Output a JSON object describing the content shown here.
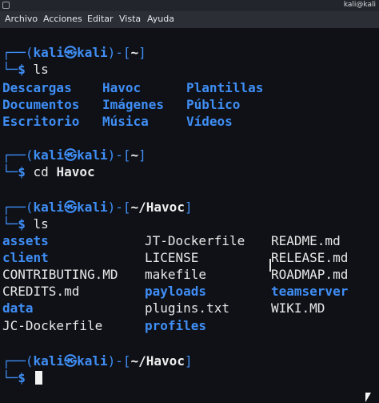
{
  "window": {
    "title": "kali@kali"
  },
  "menu": [
    "Archivo",
    "Acciones",
    "Editar",
    "Vista",
    "Ayuda"
  ],
  "prompt": {
    "user": "kali",
    "at": "㉿",
    "host": "kali",
    "home_dir": "~",
    "havoc_dir": "~/Havoc",
    "symbol": "$"
  },
  "session": [
    {
      "cwd": "~",
      "command": "ls"
    },
    {
      "cwd": "~",
      "command_name": "cd",
      "command_arg": "Havoc"
    },
    {
      "cwd": "~/Havoc",
      "command": "ls"
    },
    {
      "cwd": "~/Havoc",
      "command": ""
    }
  ],
  "home_listing": [
    [
      "Descargas",
      "Havoc",
      "Plantillas"
    ],
    [
      "Documentos",
      "Imágenes",
      "Público"
    ],
    [
      "Escritorio",
      "Música",
      "Vídeos"
    ]
  ],
  "havoc_listing": [
    [
      {
        "n": "assets",
        "t": "dir"
      },
      {
        "n": "JT-Dockerfile",
        "t": "file"
      },
      {
        "n": "README.md",
        "t": "file"
      }
    ],
    [
      {
        "n": "client",
        "t": "dir"
      },
      {
        "n": "LICENSE",
        "t": "file"
      },
      {
        "n": "RELEASE.md",
        "t": "file"
      }
    ],
    [
      {
        "n": "CONTRIBUTING.MD",
        "t": "file"
      },
      {
        "n": "makefile",
        "t": "file"
      },
      {
        "n": "ROADMAP.md",
        "t": "file"
      }
    ],
    [
      {
        "n": "CREDITS.md",
        "t": "file"
      },
      {
        "n": "payloads",
        "t": "dir"
      },
      {
        "n": "teamserver",
        "t": "dir"
      }
    ],
    [
      {
        "n": "data",
        "t": "dir"
      },
      {
        "n": "plugins.txt",
        "t": "file"
      },
      {
        "n": "WIKI.MD",
        "t": "file"
      }
    ],
    [
      {
        "n": "JC-Dockerfile",
        "t": "file"
      },
      {
        "n": "profiles",
        "t": "dir"
      },
      {
        "n": "",
        "t": "file"
      }
    ]
  ],
  "colors": {
    "background": "#0f1117",
    "prompt": "#3f8ef5",
    "directory": "#3f8ef5",
    "text": "#e8e8e8"
  }
}
